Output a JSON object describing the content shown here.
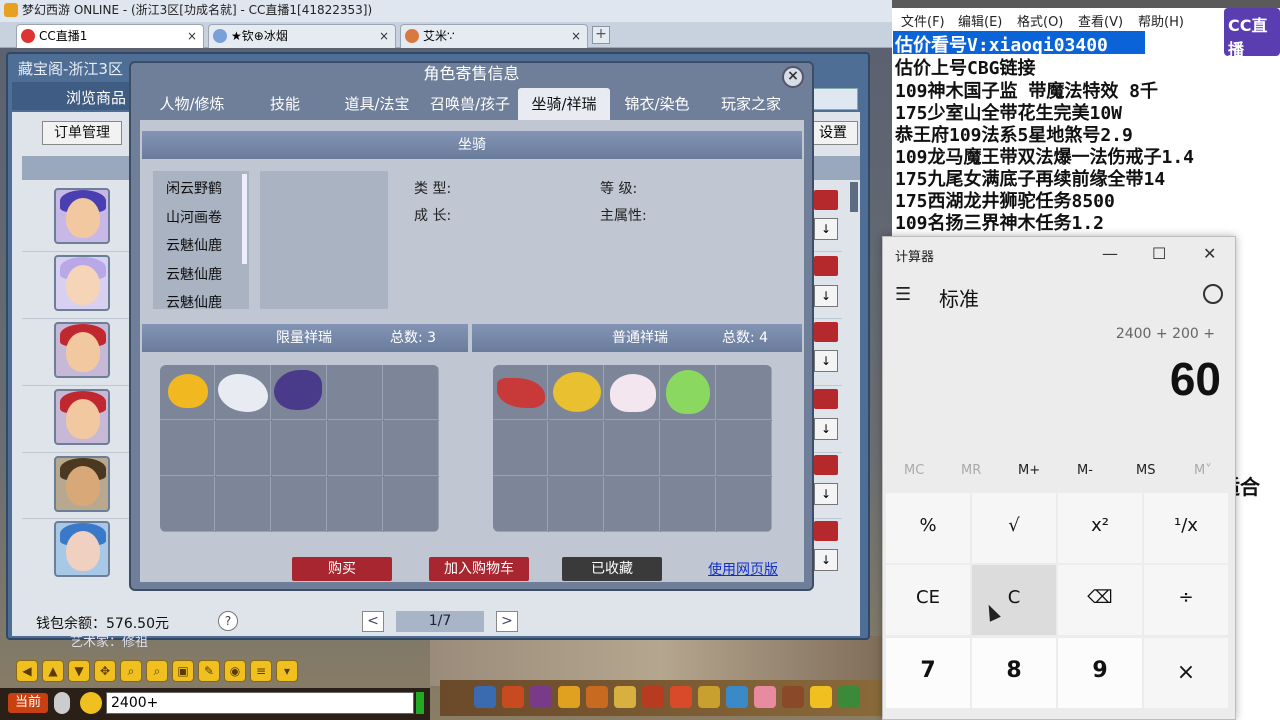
{
  "browser": {
    "window_title": "梦幻西游 ONLINE - (浙江3区[功成名就] - CC直播1[41822353])",
    "tabs": [
      {
        "label": "CC直播1",
        "active": true
      },
      {
        "label": "★钦⊕冰烟",
        "active": false
      },
      {
        "label": "艾米∵",
        "active": false
      }
    ],
    "close_glyph": "×",
    "new_tab_glyph": "+"
  },
  "cbg": {
    "title": "藏宝阁-浙江3区",
    "browse_label": "浏览商品",
    "order_button": "订单管理",
    "settings_button": "设置",
    "wallet": "钱包余额：576.50元",
    "help": "?",
    "page": "1/7",
    "prev": "<",
    "next": ">",
    "bg_text": "艺术家：修祖"
  },
  "dialog": {
    "title": "角色寄售信息",
    "close": "×",
    "tabs": [
      "人物/修炼",
      "技能",
      "道具/法宝",
      "召唤兽/孩子",
      "坐骑/祥瑞",
      "锦衣/染色",
      "玩家之家"
    ],
    "active_tab": "坐骑/祥瑞",
    "mount_section_title": "坐骑",
    "mounts": [
      "闲云野鹤",
      "山河画卷",
      "云魅仙鹿",
      "云魅仙鹿",
      "云魅仙鹿"
    ],
    "fields": {
      "type": "类  型:",
      "level": "等  级:",
      "growth": "成  长:",
      "main_attr": "主属性:"
    },
    "limited": {
      "title": "限量祥瑞",
      "count_label": "总数: 3"
    },
    "normal": {
      "title": "普通祥瑞",
      "count_label": "总数: 4"
    },
    "buy": "购买",
    "add_cart": "加入购物车",
    "favorited": "已收藏",
    "web_link": "使用网页版"
  },
  "game": {
    "channel": "当前",
    "chat_input": "2400+"
  },
  "notepad": {
    "menu": [
      "文件(F)",
      "编辑(E)",
      "格式(O)",
      "查看(V)",
      "帮助(H)"
    ],
    "lines": [
      "估价看号V:xiaoqi03400",
      "估价上号CBG链接",
      "109神木国子监 带魔法特效 8千",
      "175少室山全带花生完美10W",
      "恭王府109法系5星地煞号2.9",
      "109龙马魔王带双法爆一法伤戒子1.4",
      "175九尾女满底子再续前缘全带14",
      "175西湖龙井狮驼任务8500",
      "109名扬三界神木任务1.2"
    ],
    "tail_text": "适合",
    "logo_text": "CC直播"
  },
  "calculator": {
    "title": "计算器",
    "mode": "标准",
    "expression": "2400 + 200 +",
    "display": "60",
    "memory": [
      {
        "label": "MC",
        "enabled": false
      },
      {
        "label": "MR",
        "enabled": false
      },
      {
        "label": "M+",
        "enabled": true
      },
      {
        "label": "M-",
        "enabled": true
      },
      {
        "label": "MS",
        "enabled": true
      },
      {
        "label": "M˅",
        "enabled": false
      }
    ],
    "keys_row1": [
      "%",
      "√",
      "x²",
      "¹/x"
    ],
    "keys_row2": [
      "CE",
      "C",
      "⌫",
      "÷"
    ],
    "keys_row3": [
      "7",
      "8",
      "9",
      "×"
    ]
  }
}
